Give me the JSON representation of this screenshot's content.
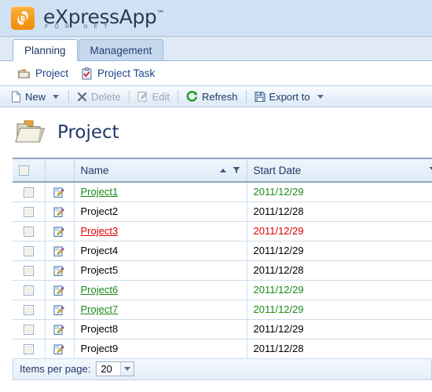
{
  "brand": {
    "title": "eXpressApp",
    "tm": "™",
    "subtitle": "F O R . N E T",
    "logo_icon": "gear-logo-icon",
    "logo_color": "#f59a18"
  },
  "tabs": [
    {
      "label": "Planning",
      "active": true
    },
    {
      "label": "Management",
      "active": false
    }
  ],
  "nav": [
    {
      "label": "Project",
      "icon": "folder-icon"
    },
    {
      "label": "Project Task",
      "icon": "clipboard-check-icon"
    }
  ],
  "toolbar": {
    "new_label": "New",
    "delete_label": "Delete",
    "edit_label": "Edit",
    "refresh_label": "Refresh",
    "export_label": "Export to",
    "new_icon": "new-page-icon",
    "delete_icon": "x-icon",
    "edit_icon": "pencil-page-icon",
    "refresh_icon": "refresh-circular-arrow-icon",
    "export_icon": "save-disk-icon"
  },
  "page": {
    "title": "Project",
    "icon": "open-folder-icon"
  },
  "grid": {
    "columns": [
      {
        "key": "check",
        "label": ""
      },
      {
        "key": "edit",
        "label": ""
      },
      {
        "key": "name",
        "label": "Name",
        "sort": "asc",
        "filter": true
      },
      {
        "key": "date",
        "label": "Start Date",
        "filter": true
      }
    ],
    "rows": [
      {
        "name": "Project1",
        "date": "2011/12/29",
        "style": "green"
      },
      {
        "name": "Project2",
        "date": "2011/12/28",
        "style": "plain"
      },
      {
        "name": "Project3",
        "date": "2011/12/29",
        "style": "red"
      },
      {
        "name": "Project4",
        "date": "2011/12/29",
        "style": "plain"
      },
      {
        "name": "Project5",
        "date": "2011/12/28",
        "style": "plain"
      },
      {
        "name": "Project6",
        "date": "2011/12/29",
        "style": "green"
      },
      {
        "name": "Project7",
        "date": "2011/12/29",
        "style": "green"
      },
      {
        "name": "Project8",
        "date": "2011/12/29",
        "style": "plain"
      },
      {
        "name": "Project9",
        "date": "2011/12/28",
        "style": "plain"
      }
    ]
  },
  "footer": {
    "items_per_page_label": "Items per page:",
    "items_per_page_value": "20"
  },
  "colors": {
    "header_bg": "#cfe1f2",
    "tab_bg": "#dfeaf6",
    "accent_green": "#1a8a1a",
    "accent_red": "#dd0000",
    "text_navy": "#1f3864"
  }
}
